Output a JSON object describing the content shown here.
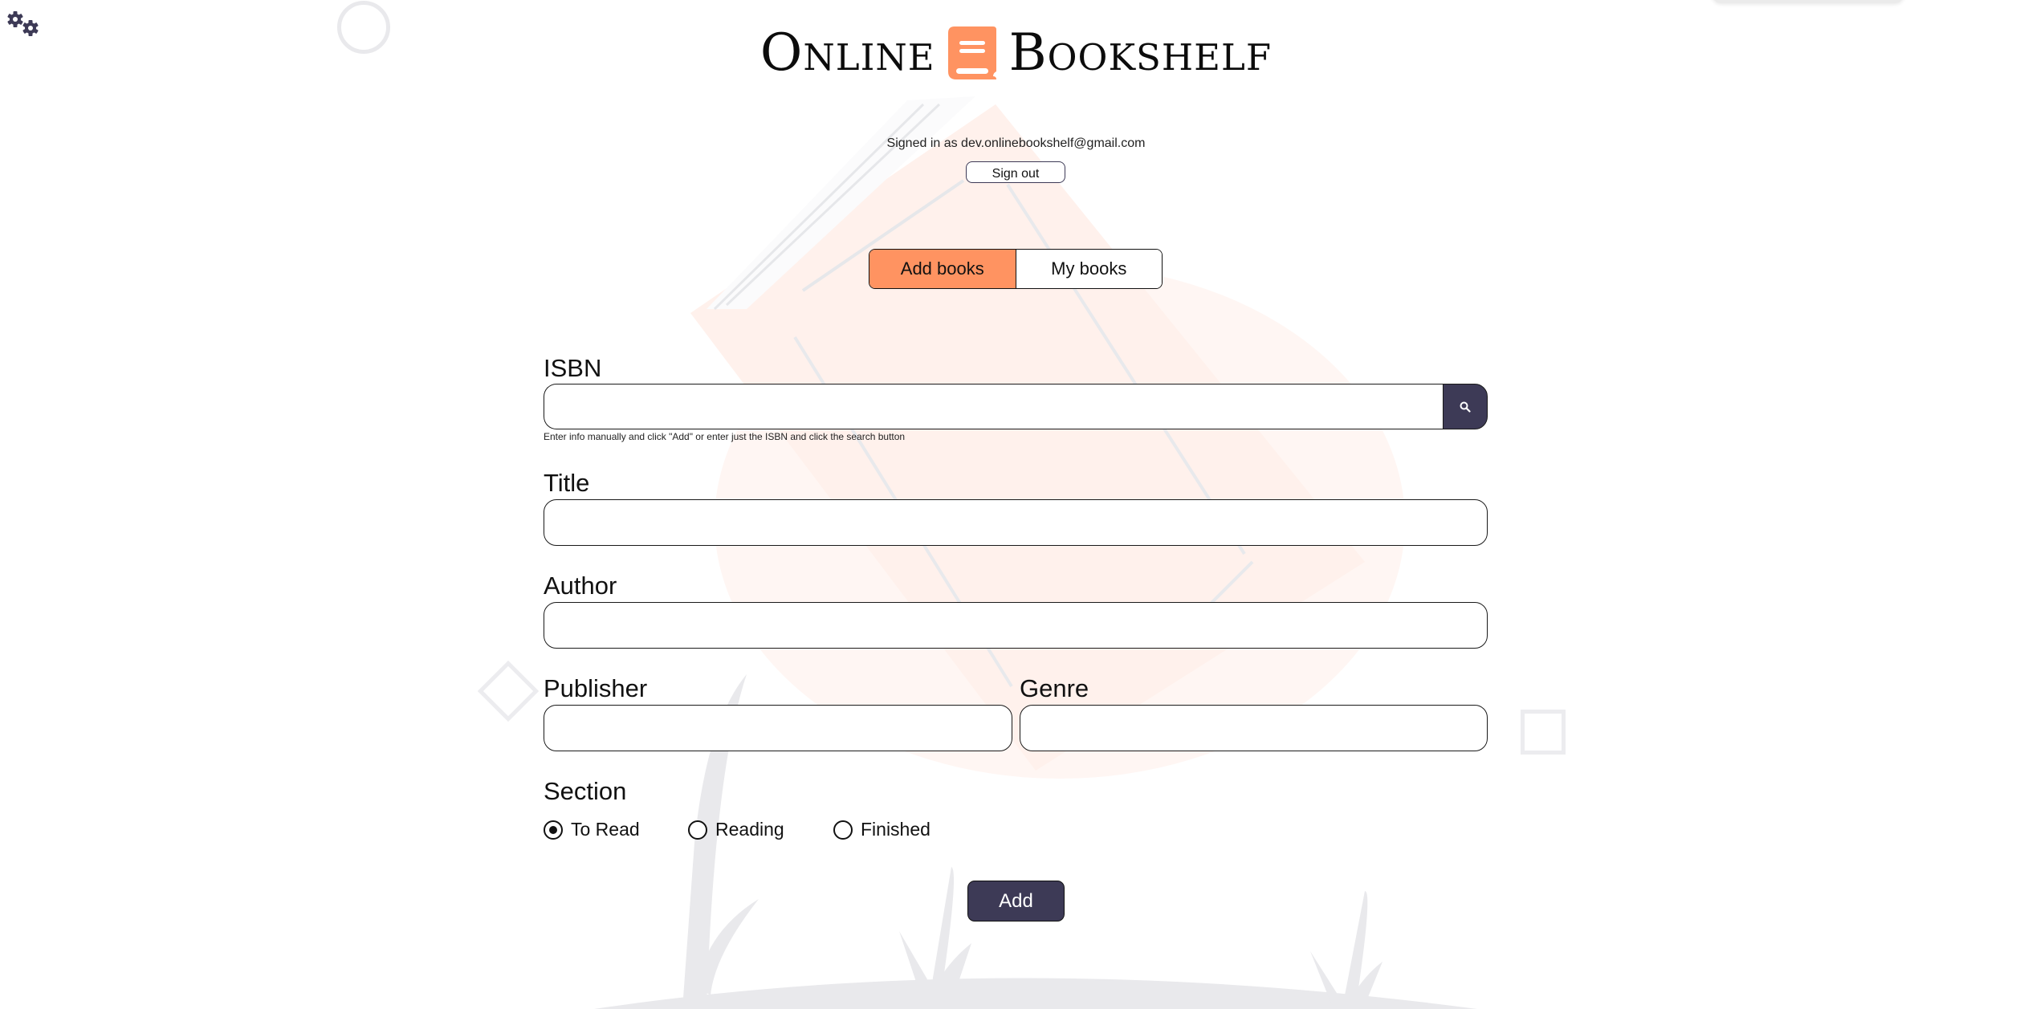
{
  "app": {
    "title_word_1": "Online",
    "title_word_2": "Bookshelf",
    "logo_icon": "book-icon",
    "settings_icon": "gears-icon"
  },
  "account": {
    "signed_in_text": "Signed in as dev.onlinebookshelf@gmail.com",
    "sign_out_label": "Sign out"
  },
  "tabs": [
    {
      "label": "Add books",
      "active": true
    },
    {
      "label": "My books",
      "active": false
    }
  ],
  "form": {
    "isbn": {
      "label": "ISBN",
      "value": "",
      "search_icon": "search-icon",
      "hint": "Enter info manually and click \"Add\" or enter just the ISBN and click the search button"
    },
    "title": {
      "label": "Title",
      "value": ""
    },
    "author": {
      "label": "Author",
      "value": ""
    },
    "publisher": {
      "label": "Publisher",
      "value": ""
    },
    "genre": {
      "label": "Genre",
      "value": ""
    },
    "section": {
      "label": "Section",
      "options": [
        {
          "label": "To Read",
          "selected": true
        },
        {
          "label": "Reading",
          "selected": false
        },
        {
          "label": "Finished",
          "selected": false
        }
      ]
    },
    "add_label": "Add"
  },
  "colors": {
    "accent": "#ff9361",
    "primary_dark": "#3d3a56",
    "decor_grey": "#e9e9ec",
    "decor_peach": "#fff3ef"
  }
}
